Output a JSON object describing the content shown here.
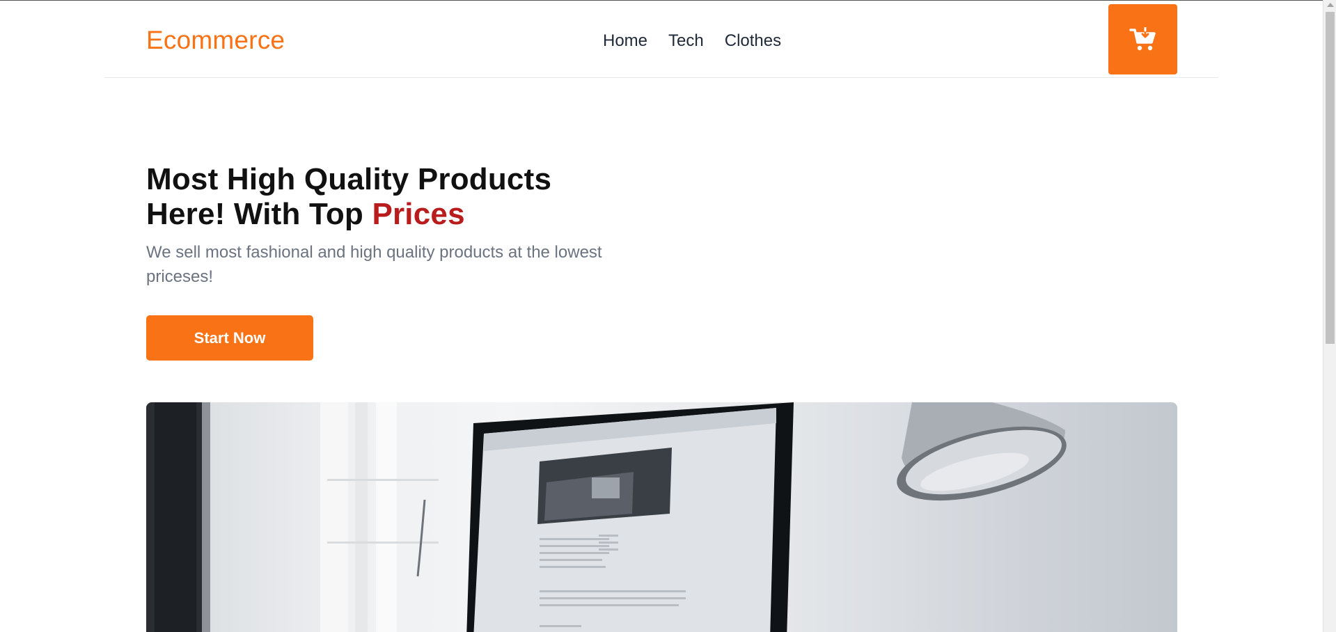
{
  "navbar": {
    "logo": "Ecommerce",
    "links": [
      {
        "label": "Home"
      },
      {
        "label": "Tech"
      },
      {
        "label": "Clothes"
      }
    ],
    "cart_icon": "cart-download-icon"
  },
  "hero": {
    "title_line1": "Most High Quality Products",
    "title_line2_prefix": "Here! With Top ",
    "title_line2_accent": "Prices",
    "subtitle": "We sell most fashional and high quality products at the lowest priceses!",
    "cta_label": "Start Now"
  },
  "colors": {
    "brand": "#f97316",
    "accent_text": "#b91c1c",
    "heading": "#111111",
    "muted": "#6b7280"
  }
}
